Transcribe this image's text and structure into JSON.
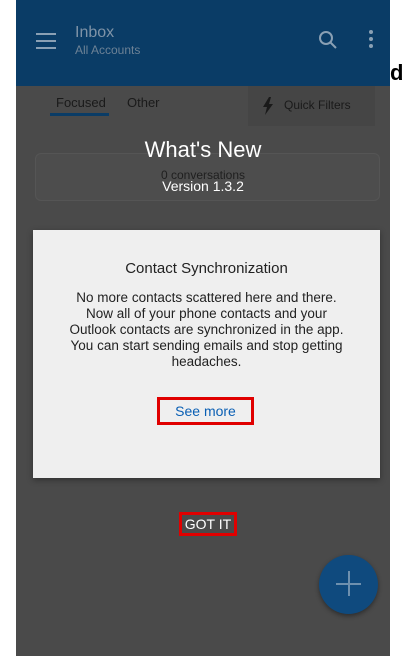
{
  "appbar": {
    "title": "Inbox",
    "subtitle": "All Accounts",
    "menu_icon": "hamburger-icon",
    "search_icon": "search-icon",
    "overflow_icon": "more-vertical-icon"
  },
  "tabs": [
    {
      "label": "Focused"
    },
    {
      "label": "Other"
    }
  ],
  "quick_filters": {
    "label": "Quick Filters",
    "icon": "lightning-icon"
  },
  "empty_state": {
    "text": "0 conversations"
  },
  "whats_new": {
    "title": "What's New",
    "version": "Version 1.3.2"
  },
  "dialog": {
    "title": "Contact Synchronization",
    "body": "No more contacts scattered here and there. Now all of your phone contacts and your Outlook contacts are synchronized in the app. You can start sending emails and stop getting headaches.",
    "see_more": "See more"
  },
  "got_it": "GOT IT",
  "fab": {
    "icon": "plus-icon"
  },
  "outside_frags": {
    "right_top": "d"
  },
  "colors": {
    "appbar": "#0a3c66",
    "overlay": "#4a4a4a",
    "dialog_bg": "#efefef",
    "link": "#0a5fb4",
    "highlight": "#e00000"
  }
}
